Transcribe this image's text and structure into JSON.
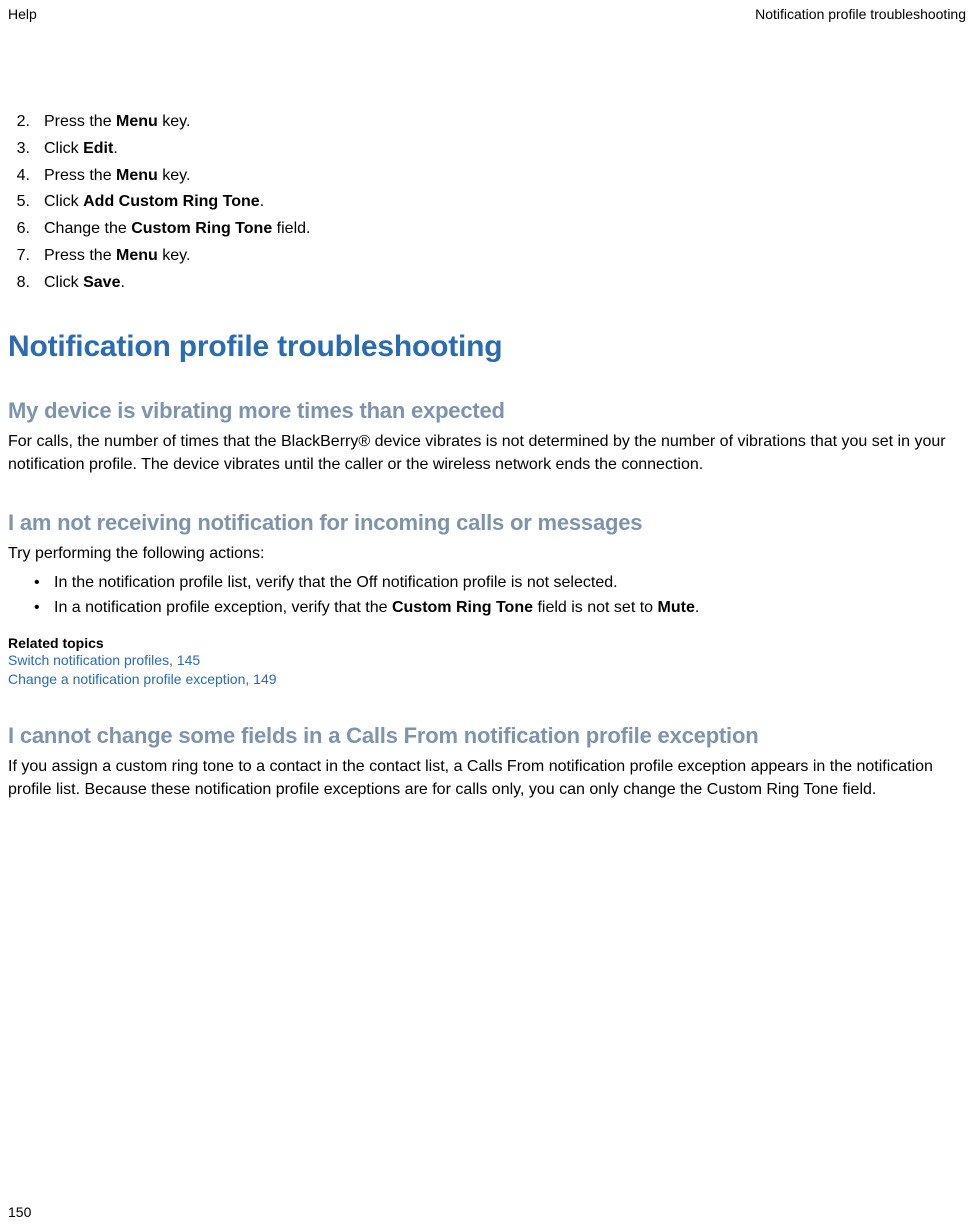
{
  "header": {
    "left": "Help",
    "right": "Notification profile troubleshooting"
  },
  "steps": [
    {
      "n": "2.",
      "pre": "Press the ",
      "bold": "Menu",
      "post": " key."
    },
    {
      "n": "3.",
      "pre": "Click ",
      "bold": "Edit",
      "post": "."
    },
    {
      "n": "4.",
      "pre": "Press the ",
      "bold": "Menu",
      "post": " key."
    },
    {
      "n": "5.",
      "pre": "Click ",
      "bold": "Add Custom Ring Tone",
      "post": "."
    },
    {
      "n": "6.",
      "pre": "Change the ",
      "bold": "Custom Ring Tone",
      "post": " field."
    },
    {
      "n": "7.",
      "pre": "Press the ",
      "bold": "Menu",
      "post": " key."
    },
    {
      "n": "8.",
      "pre": "Click ",
      "bold": "Save",
      "post": "."
    }
  ],
  "h1": "Notification profile troubleshooting",
  "sec1": {
    "title": "My device is vibrating more times than expected",
    "para": "For calls, the number of times that the BlackBerry® device vibrates is not determined by the number of vibrations that you set in your notification profile. The device vibrates until the caller or the wireless network ends the connection."
  },
  "sec2": {
    "title": "I am not receiving notification for incoming calls or messages",
    "intro": "Try performing the following actions:",
    "bullets": [
      {
        "pre": "In the notification profile list, verify that the Off notification profile is not selected.",
        "bold": "",
        "post": ""
      },
      {
        "pre": "In a notification profile exception, verify that the ",
        "bold": "Custom Ring Tone",
        "post": " field is not set to ",
        "bold2": "Mute",
        "post2": "."
      }
    ],
    "rel_head": "Related topics",
    "rel_links": [
      "Switch notification profiles, 145",
      "Change a notification profile exception, 149"
    ]
  },
  "sec3": {
    "title": "I cannot change some fields in a Calls From notification profile exception",
    "para": "If you assign a custom ring tone to a contact in the contact list, a Calls From notification profile exception appears in the notification profile list. Because these notification profile exceptions are for calls only, you can only change the Custom Ring Tone field."
  },
  "page_number": "150"
}
